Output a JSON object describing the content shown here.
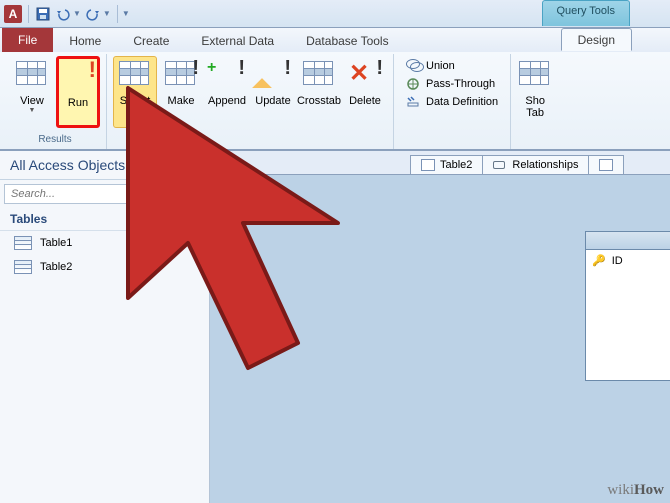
{
  "app_letter": "A",
  "context_tab_group": "Query Tools",
  "tabs": {
    "file": "File",
    "home": "Home",
    "create": "Create",
    "external": "External Data",
    "dbtools": "Database Tools",
    "design": "Design"
  },
  "ribbon": {
    "results_group": "Results",
    "view": "View",
    "run": "Run",
    "select": "Select",
    "make": "Make",
    "append": "Append",
    "update": "Update",
    "crosstab": "Crosstab",
    "delete": "Delete",
    "union": "Union",
    "passthrough": "Pass-Through",
    "datadef": "Data Definition",
    "show_table": "Sho\nTab"
  },
  "nav": {
    "header": "All Access Objects",
    "search_placeholder": "Search...",
    "category": "Tables",
    "items": [
      "Table1",
      "Table2"
    ]
  },
  "doctabs": {
    "table2": "Table2",
    "relationships": "Relationships"
  },
  "field": {
    "id": "ID"
  },
  "watermark": {
    "wiki": "wiki",
    "how": "How"
  }
}
